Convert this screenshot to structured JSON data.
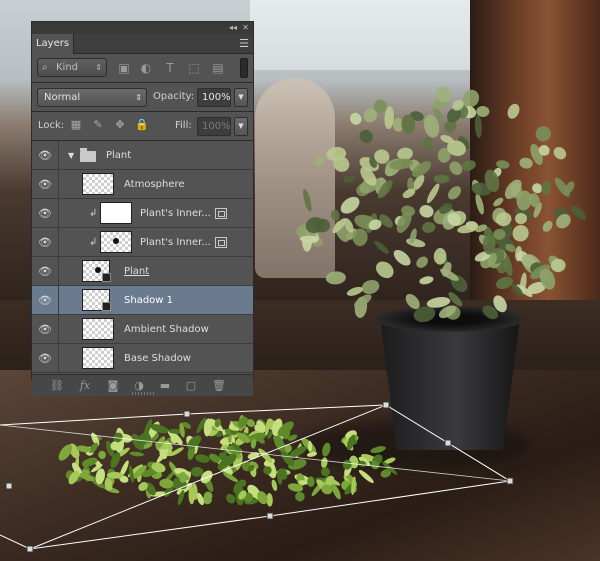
{
  "panel": {
    "tab_label": "Layers",
    "filter": {
      "kind_label": "Kind"
    },
    "blend_mode": "Normal",
    "opacity_label": "Opacity:",
    "opacity_value": "100%",
    "lock_label": "Lock:",
    "fill_label": "Fill:",
    "fill_value": "100%"
  },
  "layers": [
    {
      "name": "Plant",
      "type": "group",
      "selected": false
    },
    {
      "name": "Atmosphere",
      "type": "pixel",
      "selected": false
    },
    {
      "name": "Plant's Inner...",
      "type": "smart-clipped",
      "selected": false
    },
    {
      "name": "Plant's Inner...",
      "type": "smart-clipped",
      "selected": false
    },
    {
      "name": "Plant",
      "type": "linked",
      "selected": false
    },
    {
      "name": "Shadow 1",
      "type": "linked",
      "selected": true
    },
    {
      "name": "Ambient Shadow",
      "type": "pixel",
      "selected": false
    },
    {
      "name": "Base Shadow",
      "type": "pixel",
      "selected": false
    }
  ],
  "icons": {
    "filter": [
      "image-filter-icon",
      "adjustment-filter-icon",
      "type-filter-icon",
      "shape-filter-icon",
      "smart-object-filter-icon"
    ],
    "lock": [
      "lock-transparent-icon",
      "lock-image-icon",
      "lock-position-icon",
      "lock-all-icon"
    ],
    "bottom": [
      "link-layers-icon",
      "fx-icon",
      "mask-icon",
      "adjustment-layer-icon",
      "new-group-icon",
      "new-layer-icon",
      "delete-icon"
    ]
  },
  "colors": {
    "panel_bg": "#535353",
    "selected_row": "#6a7a8f",
    "transform_line": "#ffffff"
  }
}
